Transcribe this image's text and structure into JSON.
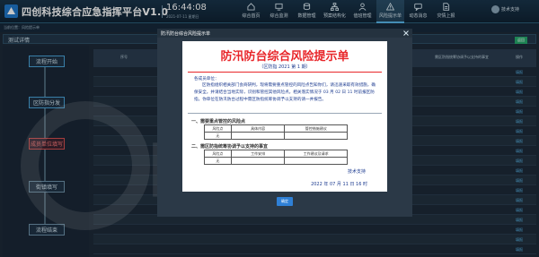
{
  "header": {
    "app_title": "四创科技综合应急指挥平台V1.0",
    "clock": "16:44:08",
    "date": "2021-07-11 星期日",
    "nav": [
      {
        "label": "综合首页",
        "icon": "home-icon",
        "active": false
      },
      {
        "label": "综合监测",
        "icon": "monitor-icon",
        "active": false
      },
      {
        "label": "数据管理",
        "icon": "database-icon",
        "active": false
      },
      {
        "label": "预案结构化",
        "icon": "structure-icon",
        "active": false
      },
      {
        "label": "值班管理",
        "icon": "duty-icon",
        "active": false
      },
      {
        "label": "风险提示单",
        "icon": "risk-icon",
        "active": true
      },
      {
        "label": "动态消息",
        "icon": "message-icon",
        "active": false
      },
      {
        "label": "灾情上报",
        "icon": "report-icon",
        "active": false
      }
    ],
    "user_name": "技术支持"
  },
  "subbar": {
    "breadcrumb": "当前位置：风险提示单"
  },
  "panel": {
    "title": "测试详情",
    "top_button": "返回"
  },
  "flow": {
    "nodes": [
      {
        "label": "流程开始",
        "state": "done"
      },
      {
        "label": "区防指分发",
        "state": "done"
      },
      {
        "label": "成员单位填写",
        "state": "current"
      },
      {
        "label": "街镇填写",
        "state": "todo"
      },
      {
        "label": "流程结束",
        "state": "todo"
      }
    ]
  },
  "table": {
    "columns": [
      "序号",
      "单位名称",
      "需要重点管控的风险点",
      "需区防指统筹协调予以支持的事宜",
      "操作"
    ],
    "row_action": "填报"
  },
  "watermark": {
    "text": "四创科技"
  },
  "modal": {
    "title": "防汛防台综合风险提示单",
    "doc_title": "防汛防台综合风险提示单",
    "doc_no": "（区防指 2021 第 1 期）",
    "to": "各成员单位：",
    "body": "区防指组织相关部门会商研判，现将需要重点管控的风险点告知你们，请迅速采取有效措施，确保安全。并请结合当地实际，识别和管控其他风险点。相关落实情况于 03 月 02 日 11 时前报区防指。你单位在防汛防台过程中需区防指统筹协调予以支持的请一并报告。",
    "section1": "一、需要重点管控的风险点",
    "table1": {
      "headers": [
        "风险点",
        "具体内容",
        "管控措施建议"
      ],
      "row": [
        "无",
        "",
        ""
      ]
    },
    "section2": "二、需区防指统筹协调予以支持的事宜",
    "table2": {
      "headers": [
        "风险点",
        "工作安排",
        "工作建议及请求"
      ],
      "row": [
        "无",
        "",
        ""
      ]
    },
    "support": "技术支持",
    "date": "2022 年 07 月 11 日 16 时",
    "ok_button": "确定"
  }
}
